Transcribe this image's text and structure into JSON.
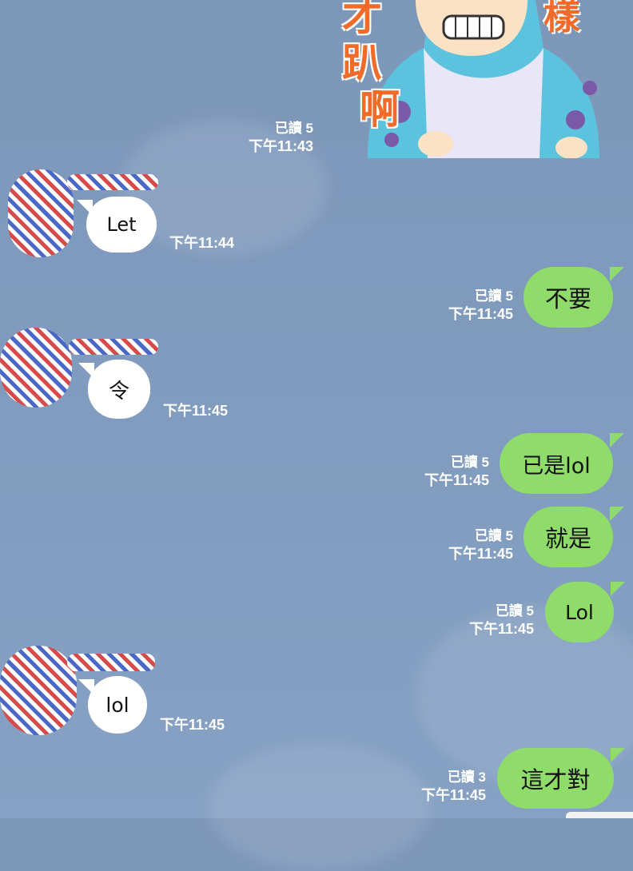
{
  "sticker": {
    "chars_left": [
      "才",
      "趴",
      "啊"
    ],
    "char_right": "樣"
  },
  "messages": [
    {
      "read": "已讀 5",
      "time": "下午11:43"
    },
    {
      "text": "Let",
      "time": "下午11:44"
    },
    {
      "text": "不要",
      "read": "已讀 5",
      "time": "下午11:45"
    },
    {
      "text": "令",
      "time": "下午11:45"
    },
    {
      "text": "已是lol",
      "read": "已讀 5",
      "time": "下午11:45"
    },
    {
      "text": "就是",
      "read": "已讀 5",
      "time": "下午11:45"
    },
    {
      "text": "Lol",
      "read": "已讀 5",
      "time": "下午11:45"
    },
    {
      "text": "lol",
      "time": "下午11:45"
    },
    {
      "text": "這才對",
      "read": "已讀 3",
      "time": "下午11:45"
    }
  ]
}
